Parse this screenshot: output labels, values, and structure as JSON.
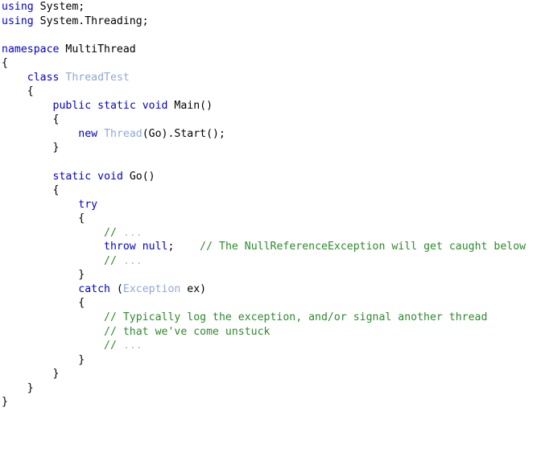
{
  "document": {
    "kind": "source-code-listing",
    "language": "C#",
    "background_color": "#ffffff",
    "colors": {
      "keyword": "#0000cd",
      "type_name": "#8fa8d8",
      "comment": "#2d8a2d",
      "plain_text": "#000000",
      "ellipsis_dots": "#b9bcb9"
    },
    "plain_text": "using System;\nusing System.Threading;\n\nnamespace MultiThread\n{\n    class ThreadTest\n    {\n        public static void Main()\n        {\n            new Thread(Go).Start();\n        }\n\n        static void Go()\n        {\n            try\n            {\n                // ...\n                throw null;    // The NullReferenceException will get caught below\n                // ...\n            }\n            catch (Exception ex)\n            {\n                // Typically log the exception, and/or signal another thread\n                // that we've come unstuck\n                // ...\n            }\n        }\n    }\n}",
    "lines": [
      {
        "id": "line-1",
        "tokens": [
          {
            "t": "using",
            "c": "kw"
          },
          {
            "t": " System;",
            "c": "plain"
          }
        ]
      },
      {
        "id": "line-2",
        "tokens": [
          {
            "t": "using",
            "c": "kw"
          },
          {
            "t": " System.Threading;",
            "c": "plain"
          }
        ]
      },
      {
        "id": "line-3",
        "tokens": []
      },
      {
        "id": "line-4",
        "tokens": [
          {
            "t": "namespace",
            "c": "kw"
          },
          {
            "t": " MultiThread",
            "c": "plain"
          }
        ]
      },
      {
        "id": "line-5",
        "tokens": [
          {
            "t": "{",
            "c": "punct"
          }
        ]
      },
      {
        "id": "line-6",
        "tokens": [
          {
            "t": "    ",
            "c": "plain"
          },
          {
            "t": "class",
            "c": "kw"
          },
          {
            "t": " ",
            "c": "plain"
          },
          {
            "t": "ThreadTest",
            "c": "type"
          }
        ]
      },
      {
        "id": "line-7",
        "tokens": [
          {
            "t": "    {",
            "c": "punct"
          }
        ]
      },
      {
        "id": "line-8",
        "tokens": [
          {
            "t": "        ",
            "c": "plain"
          },
          {
            "t": "public",
            "c": "kw"
          },
          {
            "t": " ",
            "c": "plain"
          },
          {
            "t": "static",
            "c": "kw"
          },
          {
            "t": " ",
            "c": "plain"
          },
          {
            "t": "void",
            "c": "kw"
          },
          {
            "t": " Main()",
            "c": "plain"
          }
        ]
      },
      {
        "id": "line-9",
        "tokens": [
          {
            "t": "        {",
            "c": "punct"
          }
        ]
      },
      {
        "id": "line-10",
        "tokens": [
          {
            "t": "            ",
            "c": "plain"
          },
          {
            "t": "new",
            "c": "kw"
          },
          {
            "t": " ",
            "c": "plain"
          },
          {
            "t": "Thread",
            "c": "type"
          },
          {
            "t": "(Go).Start();",
            "c": "plain"
          }
        ]
      },
      {
        "id": "line-11",
        "tokens": [
          {
            "t": "        }",
            "c": "punct"
          }
        ]
      },
      {
        "id": "line-12",
        "tokens": []
      },
      {
        "id": "line-13",
        "tokens": [
          {
            "t": "        ",
            "c": "plain"
          },
          {
            "t": "static",
            "c": "kw"
          },
          {
            "t": " ",
            "c": "plain"
          },
          {
            "t": "void",
            "c": "kw"
          },
          {
            "t": " Go()",
            "c": "plain"
          }
        ]
      },
      {
        "id": "line-14",
        "tokens": [
          {
            "t": "        {",
            "c": "punct"
          }
        ]
      },
      {
        "id": "line-15",
        "tokens": [
          {
            "t": "            ",
            "c": "plain"
          },
          {
            "t": "try",
            "c": "kw"
          }
        ]
      },
      {
        "id": "line-16",
        "tokens": [
          {
            "t": "            {",
            "c": "punct"
          }
        ]
      },
      {
        "id": "line-17",
        "tokens": [
          {
            "t": "                ",
            "c": "plain"
          },
          {
            "t": "//",
            "c": "comment"
          },
          {
            "t": " ...",
            "c": "dots"
          }
        ]
      },
      {
        "id": "line-18",
        "tokens": [
          {
            "t": "                ",
            "c": "plain"
          },
          {
            "t": "throw",
            "c": "kw"
          },
          {
            "t": " ",
            "c": "plain"
          },
          {
            "t": "null",
            "c": "kw"
          },
          {
            "t": ";",
            "c": "plain"
          },
          {
            "t": "    // The NullReferenceException will get caught below",
            "c": "comment"
          }
        ]
      },
      {
        "id": "line-19",
        "tokens": [
          {
            "t": "                ",
            "c": "plain"
          },
          {
            "t": "//",
            "c": "comment"
          },
          {
            "t": " ...",
            "c": "dots"
          }
        ]
      },
      {
        "id": "line-20",
        "tokens": [
          {
            "t": "            }",
            "c": "punct"
          }
        ]
      },
      {
        "id": "line-21",
        "tokens": [
          {
            "t": "            ",
            "c": "plain"
          },
          {
            "t": "catch",
            "c": "kw"
          },
          {
            "t": " (",
            "c": "plain"
          },
          {
            "t": "Exception",
            "c": "type"
          },
          {
            "t": " ex)",
            "c": "plain"
          }
        ]
      },
      {
        "id": "line-22",
        "tokens": [
          {
            "t": "            {",
            "c": "punct"
          }
        ]
      },
      {
        "id": "line-23",
        "tokens": [
          {
            "t": "                ",
            "c": "plain"
          },
          {
            "t": "// Typically log the exception, and/or signal another thread",
            "c": "comment"
          }
        ]
      },
      {
        "id": "line-24",
        "tokens": [
          {
            "t": "                ",
            "c": "plain"
          },
          {
            "t": "// that we've come unstuck",
            "c": "comment"
          }
        ]
      },
      {
        "id": "line-25",
        "tokens": [
          {
            "t": "                ",
            "c": "plain"
          },
          {
            "t": "//",
            "c": "comment"
          },
          {
            "t": " ...",
            "c": "dots"
          }
        ]
      },
      {
        "id": "line-26",
        "tokens": [
          {
            "t": "            }",
            "c": "punct"
          }
        ]
      },
      {
        "id": "line-27",
        "tokens": [
          {
            "t": "        }",
            "c": "punct"
          }
        ]
      },
      {
        "id": "line-28",
        "tokens": [
          {
            "t": "    }",
            "c": "punct"
          }
        ]
      },
      {
        "id": "line-29",
        "tokens": [
          {
            "t": "}",
            "c": "punct"
          }
        ]
      }
    ]
  }
}
